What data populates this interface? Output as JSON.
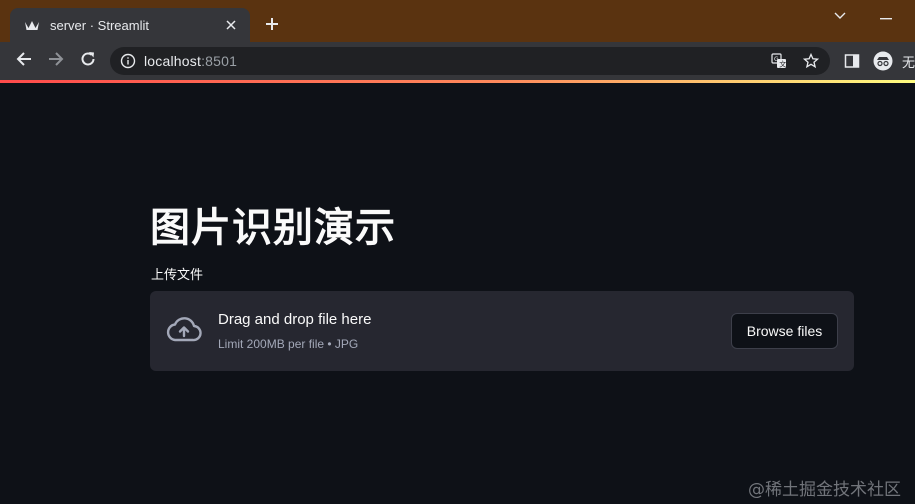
{
  "browser": {
    "tab": {
      "title": "server · Streamlit",
      "favicon": "streamlit-crown-icon"
    },
    "new_tab_icon": "plus-icon",
    "address": {
      "host": "localhost",
      "port": ":8501"
    },
    "profile_label": "无",
    "accent_gradient": [
      "#ff4b4b",
      "#fffd80"
    ]
  },
  "app": {
    "title": "图片识别演示",
    "uploader": {
      "label": "上传文件",
      "drop_text": "Drag and drop file here",
      "limit_text": "Limit 200MB per file • JPG",
      "browse_label": "Browse files"
    }
  },
  "watermark": "@稀土掘金技术社区",
  "colors": {
    "background": "#0e1117",
    "dropzone": "#262730",
    "text": "#fafafa",
    "muted": "#a3a8b8",
    "tabstrip": "#5a3310",
    "toolbar": "#35363a"
  }
}
